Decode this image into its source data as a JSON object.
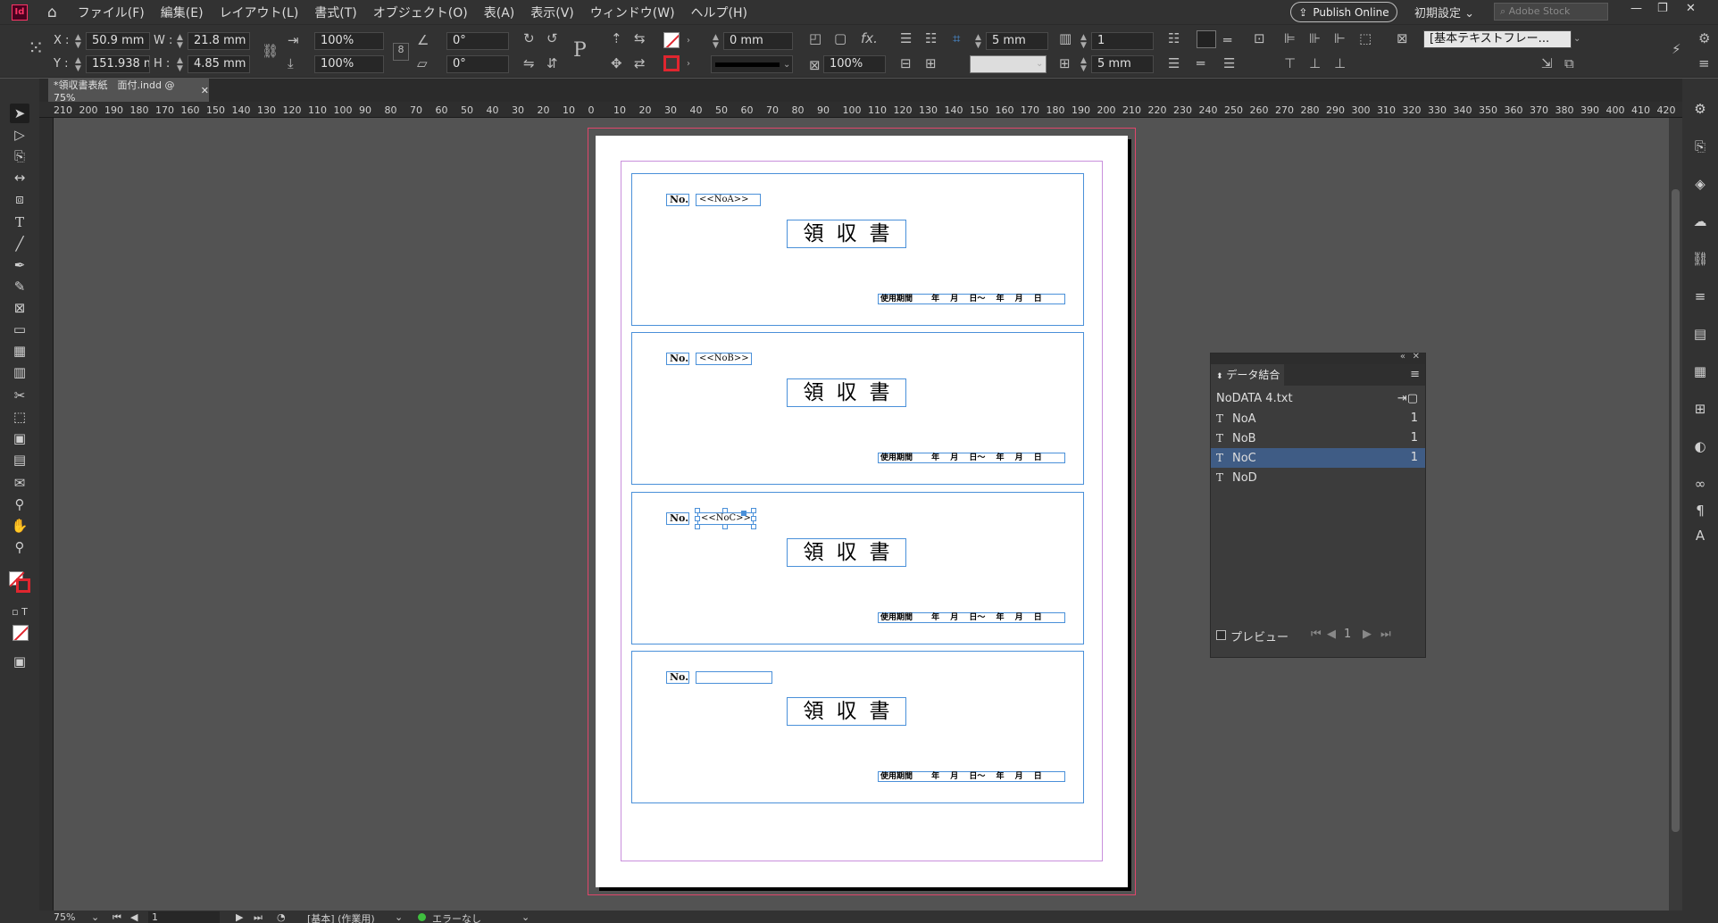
{
  "app": {
    "logo": "Id",
    "icons": {
      "home": "home-icon"
    }
  },
  "menu": [
    "ファイル(F)",
    "編集(E)",
    "レイアウト(L)",
    "書式(T)",
    "オブジェクト(O)",
    "表(A)",
    "表示(V)",
    "ウィンドウ(W)",
    "ヘルプ(H)"
  ],
  "header": {
    "publish_label": "Publish Online",
    "workspace_label": "初期設定",
    "stock_placeholder": "Adobe Stock"
  },
  "control": {
    "x_label": "X :",
    "x_value": "50.9 mm",
    "y_label": "Y :",
    "y_value": "151.938 m",
    "w_label": "W :",
    "w_value": "21.8 mm",
    "h_label": "H :",
    "h_value": "4.85 mm",
    "scale_x": "100%",
    "scale_y": "100%",
    "angle": "0°",
    "shear": "0°",
    "stroke_weight": "0 mm",
    "opacity": "100%",
    "gap": "5 mm",
    "columns": "1",
    "gutter": "5 mm",
    "frame_style": "[基本テキストフレー..."
  },
  "tab": {
    "title": "*領収書表紙　面付.indd @ 75%"
  },
  "ruler": {
    "ticks": [
      "210",
      "200",
      "190",
      "180",
      "170",
      "160",
      "150",
      "140",
      "130",
      "120",
      "110",
      "100",
      "90",
      "80",
      "70",
      "60",
      "50",
      "40",
      "30",
      "20",
      "10",
      "0",
      "10",
      "20",
      "30",
      "40",
      "50",
      "60",
      "70",
      "80",
      "90",
      "100",
      "110",
      "120",
      "130",
      "140",
      "150",
      "160",
      "170",
      "180",
      "190",
      "200",
      "210",
      "220",
      "230",
      "240",
      "250",
      "260",
      "270",
      "280",
      "290",
      "300",
      "310",
      "320",
      "330",
      "340",
      "350",
      "360",
      "370",
      "380",
      "390",
      "400",
      "410",
      "420"
    ]
  },
  "receipts": [
    {
      "no_label": "No.",
      "field": "<<NoA>>",
      "title": "領収書",
      "period": "使用期間　　 年　 月　 日～　 年　 月　 日"
    },
    {
      "no_label": "No.",
      "field": "<<NoB>>",
      "title": "領収書",
      "period": "使用期間　　 年　 月　 日～　 年　 月　 日"
    },
    {
      "no_label": "No.",
      "field": "<<NoC>>",
      "title": "領収書",
      "period": "使用期間　　 年　 月　 日～　 年　 月　 日"
    },
    {
      "no_label": "No.",
      "field": "",
      "title": "領収書",
      "period": "使用期間　　 年　 月　 日～　 年　 月　 日"
    }
  ],
  "merge_panel": {
    "title": "データ結合",
    "source": "NoDATA 4.txt",
    "fields": [
      {
        "tag": "T",
        "name": "NoA",
        "count": "1"
      },
      {
        "tag": "T",
        "name": "NoB",
        "count": "1"
      },
      {
        "tag": "T",
        "name": "NoC",
        "count": "1"
      },
      {
        "tag": "T",
        "name": "NoD",
        "count": ""
      }
    ],
    "selected_index": 2,
    "preview_label": "プレビュー",
    "record": "1"
  },
  "status": {
    "zoom": "75%",
    "page": "1",
    "preset": "[基本] (作業用)",
    "errors": "エラーなし",
    "ok_color": "#3fbf3f"
  }
}
